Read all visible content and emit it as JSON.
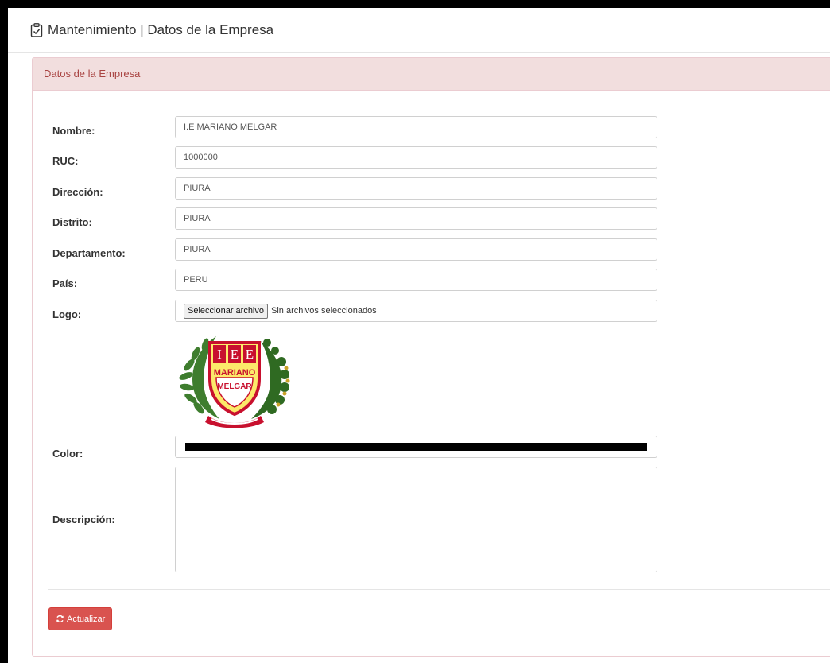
{
  "header": {
    "title": "Mantenimiento | Datos de la Empresa",
    "icon": "clipboard-check-icon"
  },
  "panel": {
    "heading": "Datos de la Empresa",
    "heading_bg": "#f2dede",
    "heading_color": "#a94442"
  },
  "form": {
    "nombre": {
      "label": "Nombre:",
      "value": "I.E MARIANO MELGAR"
    },
    "ruc": {
      "label": "RUC:",
      "value": "1000000"
    },
    "direccion": {
      "label": "Dirección:",
      "value": "PIURA"
    },
    "distrito": {
      "label": "Distrito:",
      "value": "PIURA"
    },
    "departamento": {
      "label": "Departamento:",
      "value": "PIURA"
    },
    "pais": {
      "label": "País:",
      "value": "PERU"
    },
    "logo": {
      "label": "Logo:",
      "button": "Seleccionar archivo",
      "status": "Sin archivos seleccionados",
      "image": {
        "top_letters": "I E E",
        "line1": "MARIANO",
        "line2": "MELGAR"
      }
    },
    "color": {
      "label": "Color:",
      "value": "#000000"
    },
    "descripcion": {
      "label": "Descripción:",
      "value": ""
    }
  },
  "actions": {
    "update_label": "Actualizar",
    "update_icon": "refresh-icon",
    "update_color": "#d9534f"
  }
}
